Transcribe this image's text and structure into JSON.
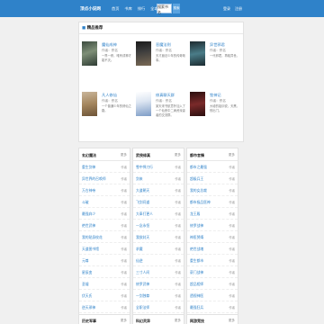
{
  "header": {
    "logo": "顶点小说网",
    "nav": [
      "首页",
      "书库",
      "排行",
      "全本",
      "书架"
    ],
    "search_placeholder": "搜索书名",
    "search_button": "搜索",
    "user_links": [
      "登录",
      "注册"
    ]
  },
  "featured": {
    "title": "精品推荐",
    "books": [
      {
        "title": "魔仙成神",
        "author": "作者：佚名",
        "desc": "一界一修，唯有成神才能不灭。"
      },
      {
        "title": "恶魔法则",
        "author": "作者：佚名",
        "desc": "天才魔法少年的传奇故事。"
      },
      {
        "title": "异世邪君",
        "author": "作者：佚名",
        "desc": "一代邪君，再临异世。"
      },
      {
        "title": "凡人修仙",
        "author": "作者：佚名",
        "desc": "一个普通少年的修仙之路。"
      },
      {
        "title": "修真聊天群",
        "author": "作者：佚名",
        "desc": "某天宋书航意外加入了一个仙侠中二病资深患者的交流群。"
      },
      {
        "title": "牧神记",
        "author": "作者：佚名",
        "desc": "大墟的祖训说，天黑，别出门。"
      }
    ]
  },
  "columns": [
    {
      "title": "玄幻魔法",
      "more": "更多",
      "rows": [
        {
          "t": "重生剑神",
          "a": "作者"
        },
        {
          "t": "异世界的召唤师",
          "a": "作者"
        },
        {
          "t": "万古神帝",
          "a": "作者"
        },
        {
          "t": "斗破",
          "a": "作者"
        },
        {
          "t": "最强弃少",
          "a": "作者"
        },
        {
          "t": "绝世武神",
          "a": "作者"
        },
        {
          "t": "我的贴身校花",
          "a": "作者"
        },
        {
          "t": "天道图书馆",
          "a": "作者"
        },
        {
          "t": "元尊",
          "a": "作者"
        },
        {
          "t": "星辰变",
          "a": "作者"
        },
        {
          "t": "圣墟",
          "a": "作者"
        },
        {
          "t": "伏天氏",
          "a": "作者"
        },
        {
          "t": "逆天邪神",
          "a": "作者"
        },
        {
          "t": "仙王的日常生活",
          "a": "作者"
        }
      ]
    },
    {
      "title": "武侠修真",
      "more": "更多",
      "rows": [
        {
          "t": "雪中悍刀行",
          "a": "作者"
        },
        {
          "t": "剑来",
          "a": "作者"
        },
        {
          "t": "大道朝天",
          "a": "作者"
        },
        {
          "t": "飞剑问道",
          "a": "作者"
        },
        {
          "t": "大奉打更人",
          "a": "作者"
        },
        {
          "t": "一念永恒",
          "a": "作者"
        },
        {
          "t": "我欲封天",
          "a": "作者"
        },
        {
          "t": "求魔",
          "a": "作者"
        },
        {
          "t": "仙逆",
          "a": "作者"
        },
        {
          "t": "三寸人间",
          "a": "作者"
        },
        {
          "t": "修罗武神",
          "a": "作者"
        },
        {
          "t": "一剑独尊",
          "a": "作者"
        },
        {
          "t": "全职法师",
          "a": "作者"
        },
        {
          "t": "武炼巅峰",
          "a": "作者"
        }
      ]
    },
    {
      "title": "都市言情",
      "more": "更多",
      "rows": [
        {
          "t": "都市之最强",
          "a": "作者"
        },
        {
          "t": "超级兵王",
          "a": "作者"
        },
        {
          "t": "我的女总裁",
          "a": "作者"
        },
        {
          "t": "都市极品医神",
          "a": "作者"
        },
        {
          "t": "龙王殿",
          "a": "作者"
        },
        {
          "t": "修罗战神",
          "a": "作者"
        },
        {
          "t": "神医赘婿",
          "a": "作者"
        },
        {
          "t": "绝世战魂",
          "a": "作者"
        },
        {
          "t": "重生都市",
          "a": "作者"
        },
        {
          "t": "豪门战神",
          "a": "作者"
        },
        {
          "t": "超品相师",
          "a": "作者"
        },
        {
          "t": "透视神医",
          "a": "作者"
        },
        {
          "t": "最强狂兵",
          "a": "作者"
        },
        {
          "t": "神级兵王",
          "a": "作者"
        }
      ]
    }
  ],
  "bottom_columns": [
    {
      "title": "历史军事",
      "more": "更多"
    },
    {
      "title": "科幻灵异",
      "more": "更多"
    },
    {
      "title": "网游竞技",
      "more": "更多"
    }
  ],
  "colors": {
    "header_bg": "#2f82c9",
    "link": "#2f82c9",
    "page_bg": "#f0f0f0"
  }
}
